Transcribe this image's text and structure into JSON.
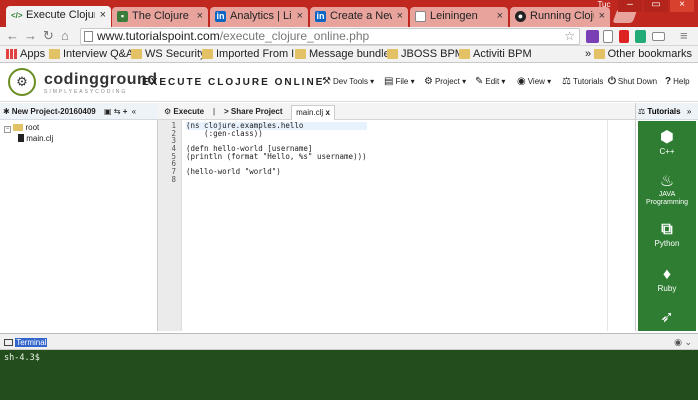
{
  "browser": {
    "tabs": [
      {
        "title": "Execute Clojure",
        "icon": "code-icon",
        "active": true
      },
      {
        "title": "The Clojure Too",
        "icon": "site-icon"
      },
      {
        "title": "Analytics | Link",
        "icon": "linkedin-icon"
      },
      {
        "title": "Create a New P",
        "icon": "linkedin-icon"
      },
      {
        "title": "Leiningen",
        "icon": "page-icon"
      },
      {
        "title": "Running Clojure",
        "icon": "github-icon"
      }
    ],
    "window_label": "Tuc",
    "url_host": "www.tutorialspoint.com",
    "url_path": "/execute_clojure_online.php",
    "bookmarks": [
      "Apps",
      "Interview Q&A",
      "WS Security",
      "Imported From I",
      "Message bundle",
      "JBOSS BPM",
      "Activiti BPM"
    ],
    "bookmarks_overflow": "»",
    "other_bookmarks": "Other bookmarks"
  },
  "app": {
    "brand": "codingground",
    "brand_sub": "SIMPLYEASYCODING",
    "title": "EXECUTE CLOJURE ONLINE",
    "menu": [
      "Dev Tools",
      "File",
      "Project",
      "Edit",
      "View",
      "Tutorials",
      "Shut Down",
      "Help"
    ]
  },
  "project": {
    "name": "New Project-20160409",
    "collapse": "«",
    "tree_root": "root",
    "tree_file": "main.clj"
  },
  "editor": {
    "execute_label": "Execute",
    "separator": "|",
    "share_label": "Share Project",
    "file_tab": "main.clj",
    "file_tab_close": "x",
    "line_numbers": [
      "1",
      "2",
      "3",
      "4",
      "5",
      "6",
      "7",
      "8"
    ],
    "code_lines": [
      "(ns clojure.examples.hello",
      "    (:gen-class))",
      "",
      "(defn hello-world [username]",
      "(println (format \"Hello, %s\" username)))",
      "",
      "(hello-world \"world\")",
      ""
    ]
  },
  "tutorials": {
    "header": "Tutorials",
    "expand": "»",
    "languages": [
      "C++",
      "JAVA Programming",
      "Python",
      "Ruby",
      "Swift"
    ]
  },
  "terminal": {
    "tab_label": "Terminal",
    "prompt": "sh-4.3$"
  },
  "colors": {
    "chrome_tabstrip": "#c0281f",
    "terminal_bg": "#244d1e",
    "language_panel": "#2e7d32",
    "selection_blue": "#3366cc"
  }
}
